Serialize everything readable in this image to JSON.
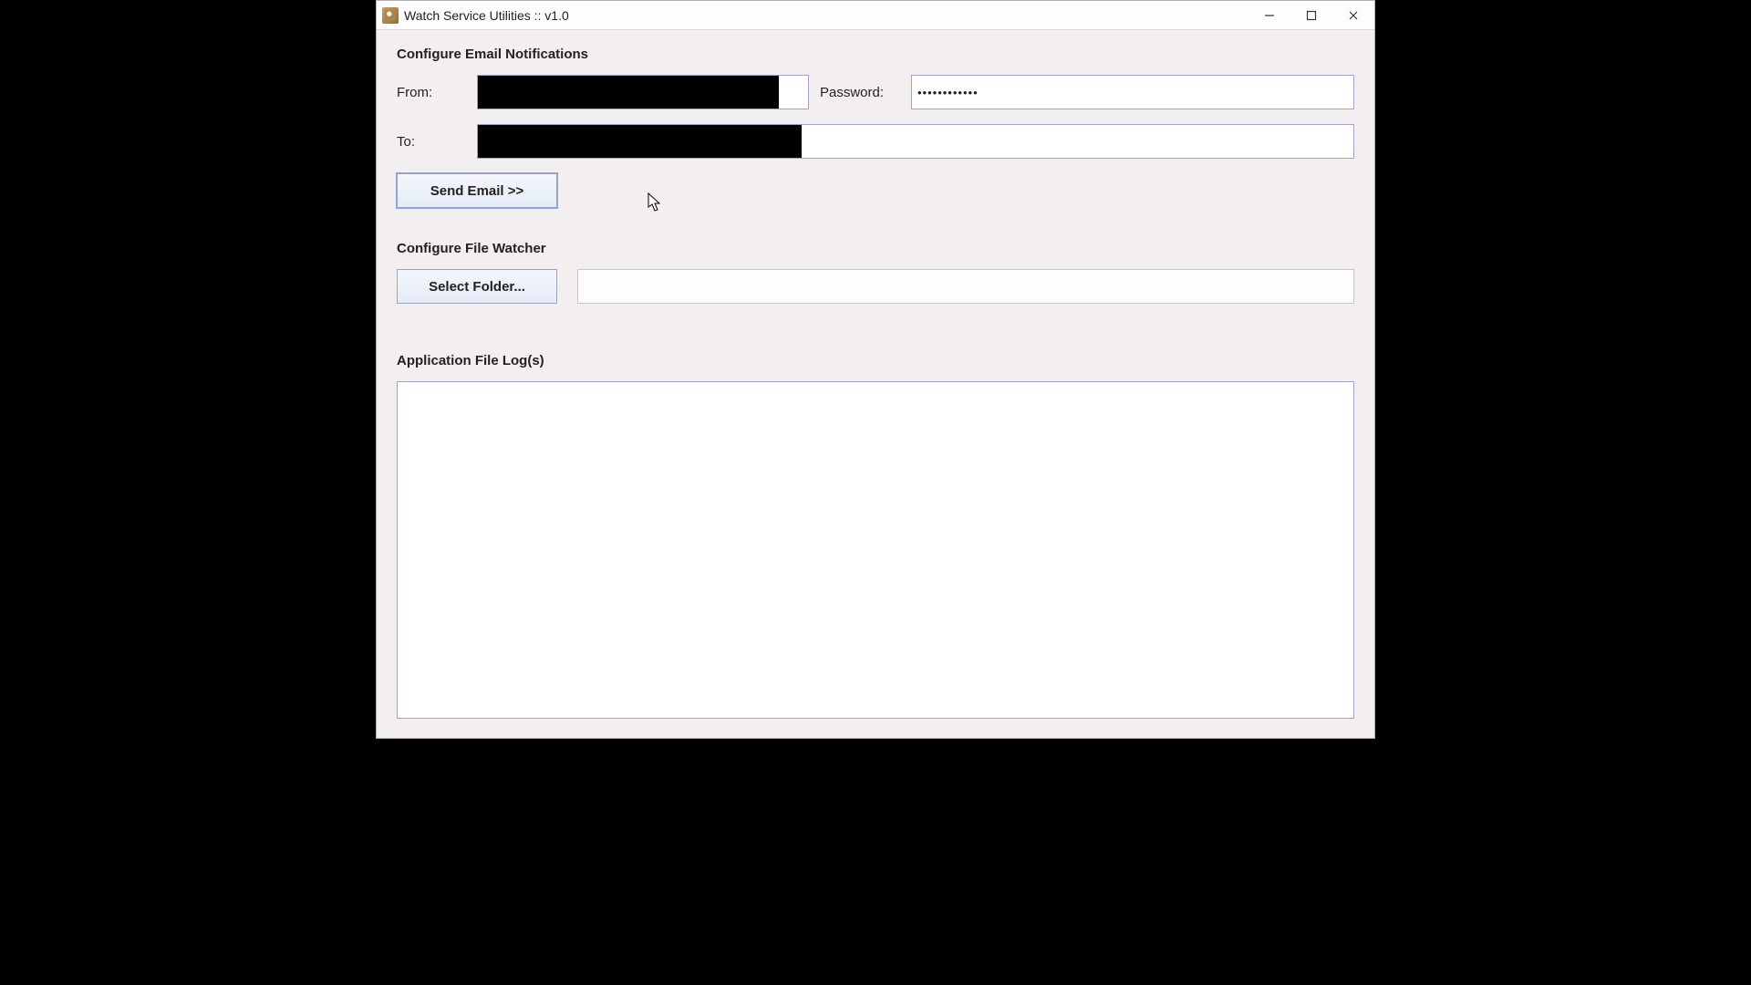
{
  "window": {
    "title": "Watch Service Utilities :: v1.0"
  },
  "email_section": {
    "heading": "Configure Email Notifications",
    "from_label": "From:",
    "from_value": "",
    "password_label": "Password:",
    "password_value": "••••••••••••",
    "to_label": "To:",
    "to_value": "",
    "send_button": "Send Email >>"
  },
  "watcher_section": {
    "heading": "Configure File Watcher",
    "select_button": "Select Folder...",
    "folder_path": ""
  },
  "log_section": {
    "heading": "Application File Log(s)",
    "content": ""
  }
}
